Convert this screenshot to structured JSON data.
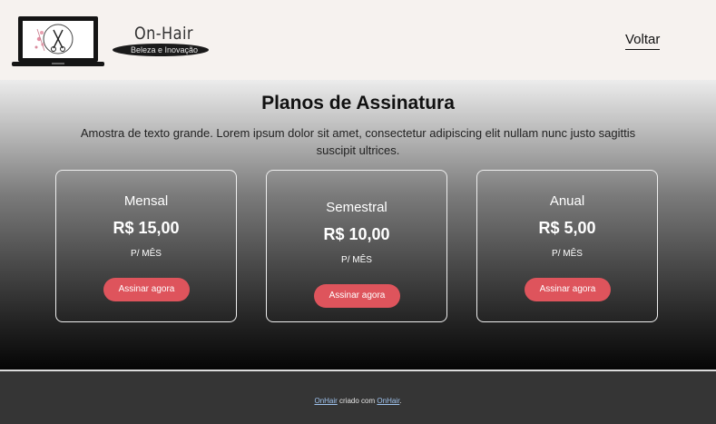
{
  "header": {
    "brand_name": "On-Hair",
    "brand_tagline": "Beleza e Inovação",
    "back_label": "Voltar"
  },
  "main": {
    "title": "Planos de Assinatura",
    "description": "Amostra de texto grande. Lorem ipsum dolor sit amet, consectetur adipiscing elit nullam nunc justo sagittis suscipit ultrices.",
    "plans": [
      {
        "name": "Mensal",
        "price": "R$ 15,00",
        "period": "P/ MÊS",
        "button": "Assinar agora"
      },
      {
        "name": "Semestral",
        "price": "R$ 10,00",
        "period": "P/ MÊS",
        "button": "Assinar agora"
      },
      {
        "name": "Anual",
        "price": "R$ 5,00",
        "period": "P/ MÊS",
        "button": "Assinar agora"
      }
    ]
  },
  "footer": {
    "link1": "OnHair",
    "middle": " criado com ",
    "link2": "OnHair",
    "end": "."
  },
  "colors": {
    "header_bg": "#f6f2ef",
    "button": "#de545c",
    "footer_bg": "#353535",
    "footer_link": "#9fc3ee"
  },
  "icons": [
    "laptop-logo-icon",
    "scissors-icon"
  ]
}
